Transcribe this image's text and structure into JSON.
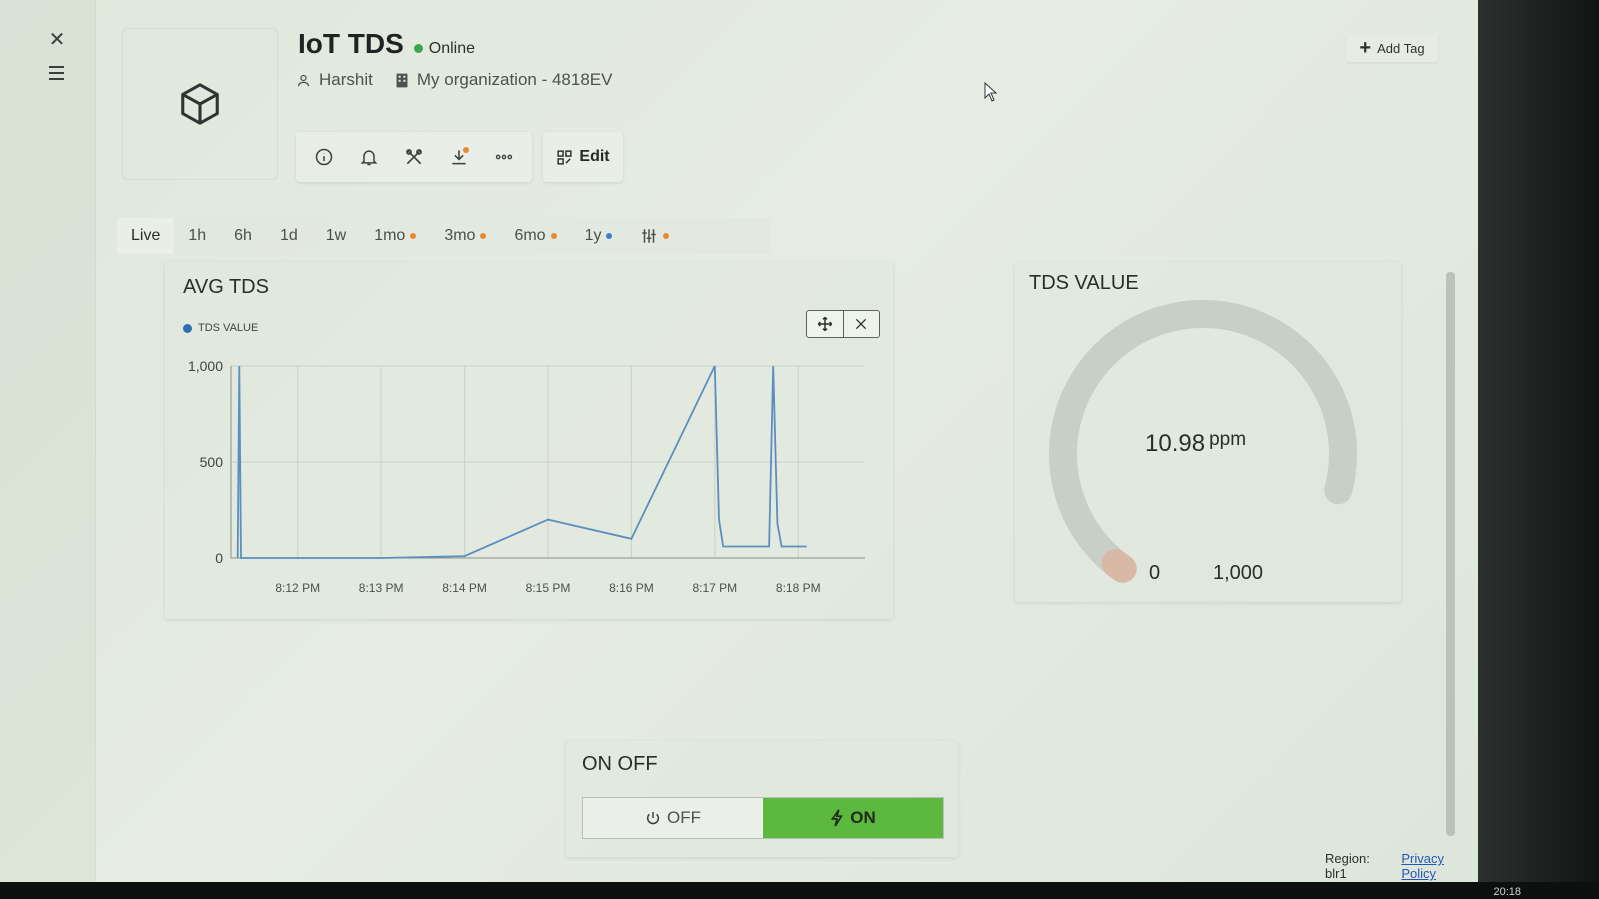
{
  "header": {
    "device_name": "IoT TDS",
    "status": "Online",
    "owner": "Harshit",
    "organization": "My organization - 4818EV",
    "edit_label": "Edit",
    "add_tag_label": "Add Tag"
  },
  "toolbar": {
    "icons": [
      "info-icon",
      "bell-icon",
      "tools-icon",
      "download-icon",
      "more-icon"
    ]
  },
  "ranges": [
    {
      "label": "Live",
      "active": true,
      "dot": null
    },
    {
      "label": "1h",
      "active": false,
      "dot": null
    },
    {
      "label": "6h",
      "active": false,
      "dot": null
    },
    {
      "label": "1d",
      "active": false,
      "dot": null
    },
    {
      "label": "1w",
      "active": false,
      "dot": null
    },
    {
      "label": "1mo",
      "active": false,
      "dot": "#e8892f"
    },
    {
      "label": "3mo",
      "active": false,
      "dot": "#e8892f"
    },
    {
      "label": "6mo",
      "active": false,
      "dot": "#e8892f"
    },
    {
      "label": "1y",
      "active": false,
      "dot": "#3c7fd0"
    }
  ],
  "chart_card": {
    "title": "AVG TDS",
    "legend_label": "TDS VALUE",
    "legend_color": "#2c6fb3"
  },
  "chart_data": {
    "type": "line",
    "title": "AVG TDS",
    "xlabel": "",
    "ylabel": "",
    "x_ticks": [
      "8:12 PM",
      "8:13 PM",
      "8:14 PM",
      "8:15 PM",
      "8:16 PM",
      "8:17 PM",
      "8:18 PM"
    ],
    "y_ticks": [
      0,
      500,
      1000
    ],
    "y_tick_labels": [
      "0",
      "500",
      "1,000"
    ],
    "ylim": [
      0,
      1000
    ],
    "xlim": [
      -0.8,
      6.8
    ],
    "grid": true,
    "legend": "top-left",
    "series": [
      {
        "name": "TDS VALUE",
        "color": "#5a8fc0",
        "points": [
          [
            -0.72,
            0
          ],
          [
            -0.7,
            1000
          ],
          [
            -0.68,
            0
          ],
          [
            0.0,
            0
          ],
          [
            1.0,
            0
          ],
          [
            2.0,
            10
          ],
          [
            3.0,
            200
          ],
          [
            4.0,
            100
          ],
          [
            5.0,
            1000
          ],
          [
            5.05,
            200
          ],
          [
            5.1,
            60
          ],
          [
            5.3,
            60
          ],
          [
            5.65,
            60
          ],
          [
            5.7,
            1000
          ],
          [
            5.75,
            180
          ],
          [
            5.8,
            60
          ],
          [
            6.1,
            60
          ]
        ]
      }
    ]
  },
  "gauge_card": {
    "title": "TDS VALUE",
    "value": "10.98",
    "unit": "ppm",
    "min_label": "0",
    "max_label": "1,000",
    "value_num": 10.98,
    "min": 0,
    "max": 1000
  },
  "switch_card": {
    "title": "ON OFF",
    "off_label": "OFF",
    "on_label": "ON",
    "state": "ON"
  },
  "footer": {
    "region": "Region: blr1",
    "privacy": "Privacy Policy"
  },
  "clock": "20:18",
  "colors": {
    "online": "#3aa64a",
    "on_button": "#5cb83f",
    "link": "#2457b8"
  }
}
